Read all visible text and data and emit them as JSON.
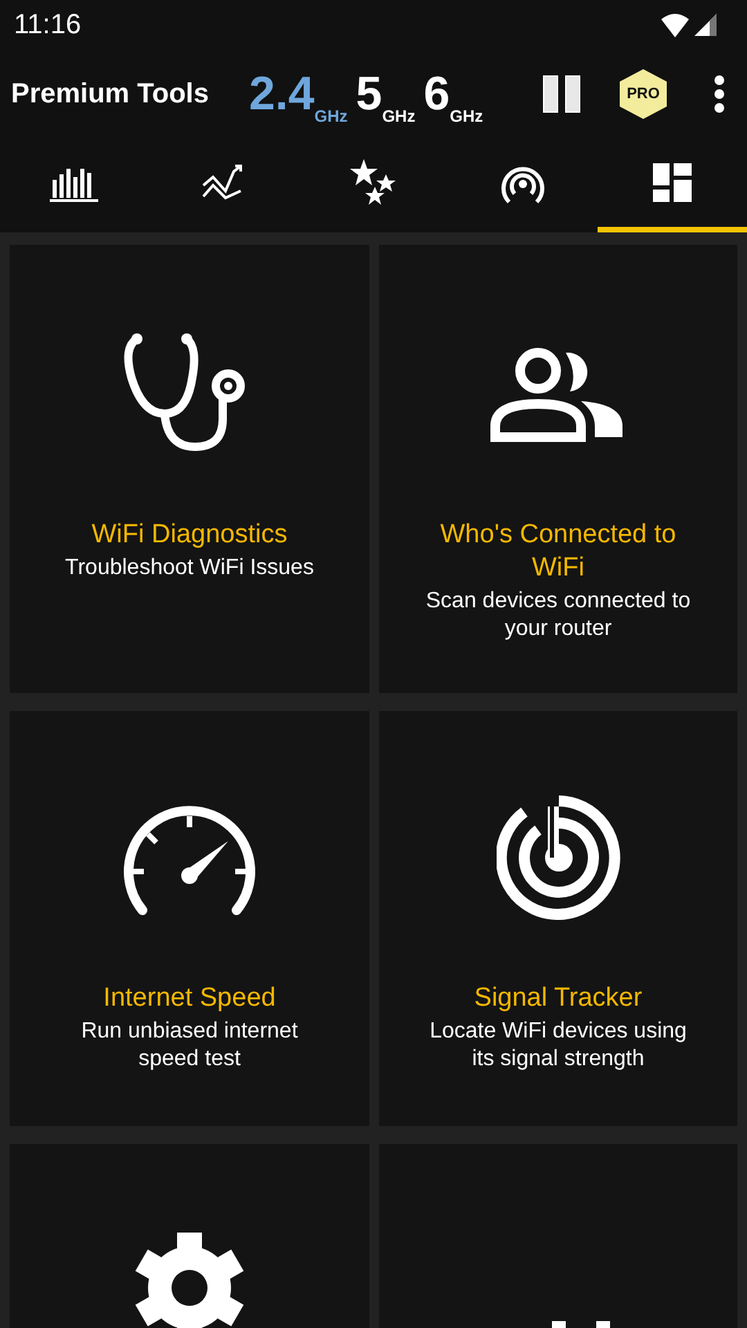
{
  "status_bar": {
    "time": "11:16"
  },
  "toolbar": {
    "title": "Premium Tools",
    "bands": [
      {
        "value": "2.4",
        "unit": "GHz",
        "selected": true
      },
      {
        "value": "5",
        "unit": "GHz",
        "selected": false
      },
      {
        "value": "6",
        "unit": "GHz",
        "selected": false
      }
    ],
    "pro_badge": "PRO"
  },
  "tabs": [
    {
      "selected": false
    },
    {
      "selected": false
    },
    {
      "selected": false
    },
    {
      "selected": false
    },
    {
      "selected": true
    }
  ],
  "tools": [
    {
      "title": "WiFi Diagnostics",
      "description": "Troubleshoot WiFi Issues"
    },
    {
      "title": "Who's Connected to WiFi",
      "description": "Scan devices connected to your router"
    },
    {
      "title": "Internet Speed",
      "description": "Run unbiased internet speed test"
    },
    {
      "title": "Signal Tracker",
      "description": "Locate WiFi devices using its signal strength"
    }
  ]
}
